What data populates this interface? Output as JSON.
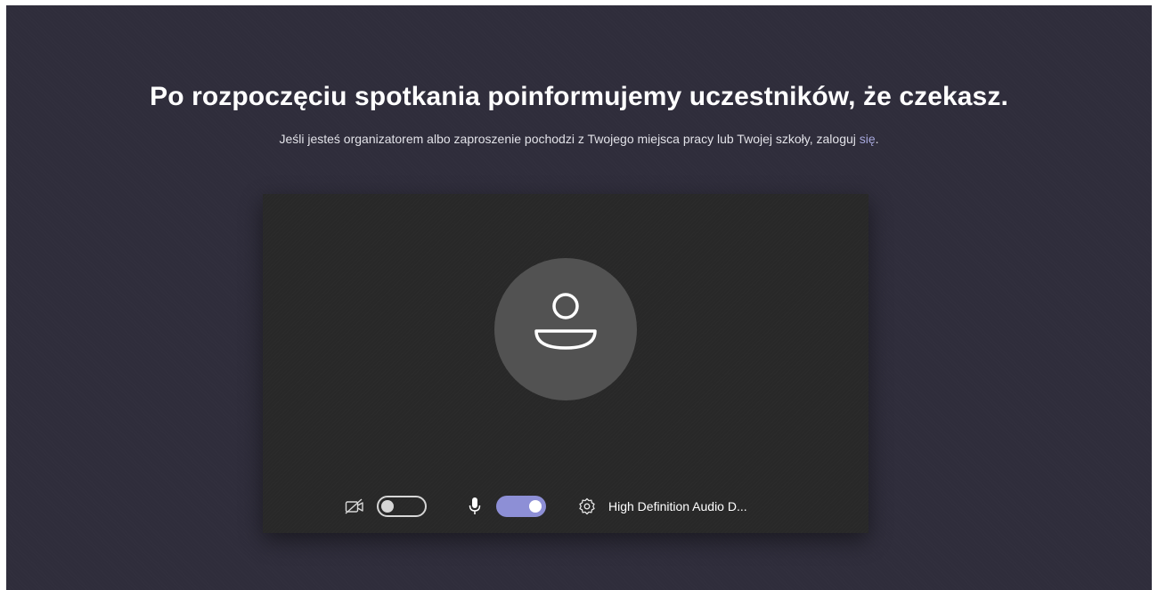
{
  "header": {
    "title": "Po rozpoczęciu spotkania poinformujemy uczestników, że czekasz.",
    "subtitle_text": "Jeśli jesteś organizatorem albo zaproszenie pochodzi z Twojego miejsca pracy lub Twojej szkoły, zaloguj ",
    "subtitle_link": "się",
    "subtitle_end": "."
  },
  "preview": {
    "avatar_icon": "person-icon",
    "camera": {
      "icon": "camera-off-icon",
      "enabled": false
    },
    "microphone": {
      "icon": "microphone-icon",
      "enabled": true
    },
    "device_settings": {
      "icon": "gear-icon",
      "label": "High Definition Audio D..."
    }
  },
  "colors": {
    "background": "#2f2d3b",
    "preview_background": "#282828",
    "avatar_circle": "#525252",
    "accent": "#8d8fd6",
    "link": "#a6a7dc"
  }
}
